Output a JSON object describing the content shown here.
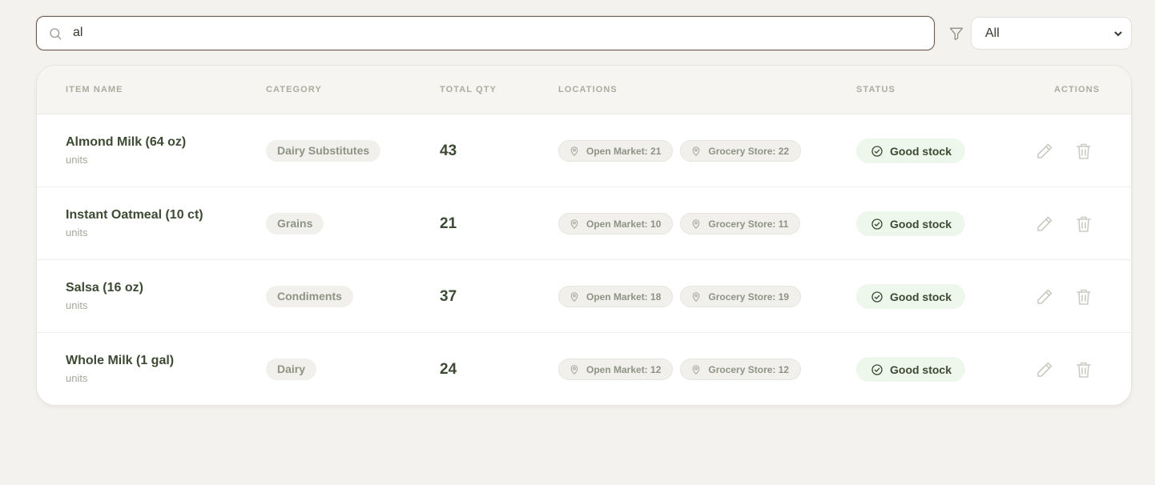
{
  "search": {
    "value": "al",
    "placeholder": ""
  },
  "filter": {
    "selected": "All"
  },
  "table": {
    "headers": {
      "item_name": "ITEM NAME",
      "category": "CATEGORY",
      "total_qty": "TOTAL QTY",
      "locations": "LOCATIONS",
      "status": "STATUS",
      "actions": "ACTIONS"
    },
    "rows": [
      {
        "name": "Almond Milk (64 oz)",
        "unit": "units",
        "category": "Dairy Substitutes",
        "qty": "43",
        "locations": [
          "Open Market: 21",
          "Grocery Store: 22"
        ],
        "status": "Good stock"
      },
      {
        "name": "Instant Oatmeal (10 ct)",
        "unit": "units",
        "category": "Grains",
        "qty": "21",
        "locations": [
          "Open Market: 10",
          "Grocery Store: 11"
        ],
        "status": "Good stock"
      },
      {
        "name": "Salsa (16 oz)",
        "unit": "units",
        "category": "Condiments",
        "qty": "37",
        "locations": [
          "Open Market: 18",
          "Grocery Store: 19"
        ],
        "status": "Good stock"
      },
      {
        "name": "Whole Milk (1 gal)",
        "unit": "units",
        "category": "Dairy",
        "qty": "24",
        "locations": [
          "Open Market: 12",
          "Grocery Store: 12"
        ],
        "status": "Good stock"
      }
    ]
  },
  "icons": {
    "search": "search-icon",
    "filter": "filter-icon",
    "chevron": "chevron-down-icon",
    "location": "map-pin-icon",
    "status": "check-circle-icon",
    "edit": "pencil-icon",
    "delete": "trash-icon"
  },
  "colors": {
    "background": "#f3f2ee",
    "text": "#3d4a33",
    "muted": "#a9ad9f",
    "status_bg": "#eef7ec",
    "chip_bg": "#f1f0ec",
    "search_border": "#6b5a4e"
  }
}
